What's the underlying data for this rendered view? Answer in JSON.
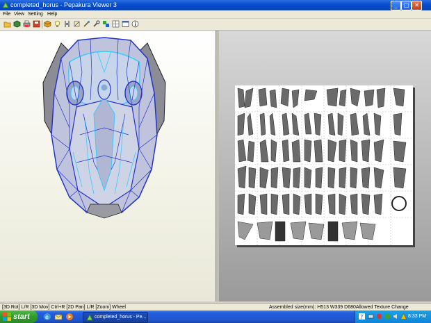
{
  "window": {
    "title": "completed_horus - Pepakura Viewer 3",
    "minimize": "_",
    "maximize": "□",
    "close": "✕"
  },
  "menu": [
    "File",
    "View",
    "Setting",
    "Help"
  ],
  "toolbar": [
    "open-icon",
    "cube-icon",
    "print-icon",
    "save-icon",
    "box-icon",
    "bulb-icon",
    "pin-icon",
    "tools-icon",
    "brush-icon",
    "wrench-icon",
    "layers-icon",
    "grid-icon",
    "window-icon",
    "window-icon",
    "info-icon"
  ],
  "status": {
    "left": "[3D Rot] L/R [3D Mov] Ctrl+R [2D Pan] L/R [Zoom] Wheel",
    "right": "Assembled size(mm): H513 W339 D680Allowed Texture Change"
  },
  "taskbar": {
    "start": "start",
    "task": "completed_horus - Pe...",
    "clock": "8:33 PM"
  },
  "colors": {
    "mesh_blue": "#2233cc",
    "mesh_cyan": "#33ccff",
    "mesh_fill": "#b8bdd8",
    "paper_parts": "#6a6a6a"
  }
}
